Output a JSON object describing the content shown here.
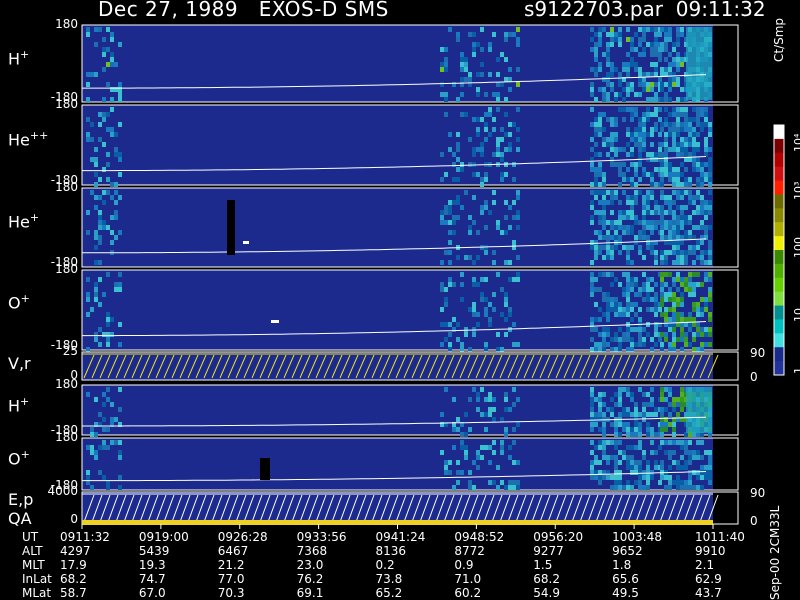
{
  "header": {
    "title": "Dec 27, 1989   EXOS-D SMS",
    "file": "s9122703.par  09:11:32"
  },
  "panels": [
    {
      "label_base": "H",
      "label_sup": "+",
      "top_tick": "180",
      "bottom_tick": "-180"
    },
    {
      "label_base": "He",
      "label_sup": "++",
      "top_tick": "180",
      "bottom_tick": "-180"
    },
    {
      "label_base": "He",
      "label_sup": "+",
      "top_tick": "180",
      "bottom_tick": "-180"
    },
    {
      "label_base": "O",
      "label_sup": "+",
      "top_tick": "180",
      "bottom_tick": "-180"
    },
    {
      "label_base": "V,r",
      "label_sup": "",
      "top_tick": "25",
      "bottom_tick": "0",
      "right_top": "90",
      "right_bottom": "0"
    },
    {
      "label_base": "H",
      "label_sup": "+",
      "top_tick": "180",
      "bottom_tick": "-180"
    },
    {
      "label_base": "O",
      "label_sup": "+",
      "top_tick": "180",
      "bottom_tick": "-180"
    },
    {
      "label_base": "E,p",
      "label_sup": "",
      "label2": "QA",
      "top_tick": "4000",
      "bottom_tick": "0",
      "right_top": "90",
      "right_bottom": "0"
    }
  ],
  "colorbar": {
    "unit": "Ct/Smp",
    "labels": [
      "10⁴",
      "10³",
      "100",
      "10",
      "1"
    ],
    "colors": [
      "#ffffff",
      "#7a0000",
      "#b00000",
      "#d01010",
      "#ff2000",
      "#6a6a00",
      "#8a8a00",
      "#b0b000",
      "#f0f000",
      "#3a8a00",
      "#50b000",
      "#66d000",
      "#80e040",
      "#009090",
      "#00c0c0",
      "#40e0e0",
      "#1a2a8a",
      "#223399"
    ]
  },
  "orbit": {
    "rows": [
      {
        "name": "UT",
        "values": [
          "0911:32",
          "0919:00",
          "0926:28",
          "0933:56",
          "0941:24",
          "0948:52",
          "0956:20",
          "1003:48",
          "1011:40"
        ]
      },
      {
        "name": "ALT",
        "values": [
          "4297",
          "5439",
          "6467",
          "7368",
          "8136",
          "8772",
          "9277",
          "9652",
          "9910"
        ]
      },
      {
        "name": "MLT",
        "values": [
          "17.9",
          "19.3",
          "21.2",
          "23.0",
          "0.2",
          "0.9",
          "1.5",
          "1.8",
          "2.1"
        ]
      },
      {
        "name": "InLat",
        "values": [
          "68.2",
          "74.7",
          "77.0",
          "76.2",
          "73.8",
          "71.0",
          "68.2",
          "65.6",
          "62.9"
        ]
      },
      {
        "name": "MLat",
        "values": [
          "58.7",
          "67.0",
          "70.3",
          "69.1",
          "65.2",
          "60.2",
          "54.9",
          "49.5",
          "43.7"
        ]
      }
    ]
  },
  "footer_stamp": "Sep-00 2CM33L",
  "chart_data": {
    "type": "heatmap",
    "title": "Dec 27, 1989   EXOS-D SMS",
    "x_ticks": [
      "0911:32",
      "0919:00",
      "0926:28",
      "0933:56",
      "0941:24",
      "0948:52",
      "0956:20",
      "1003:48",
      "1011:40"
    ],
    "panels": [
      "H+",
      "He++",
      "He+",
      "O+",
      "V,r",
      "H+",
      "O+",
      "E,p / QA"
    ],
    "y_range_pitch": [
      -180,
      180
    ],
    "colorbar_unit": "Ct/Smp",
    "colorbar_range": [
      1,
      10000
    ],
    "log_scale": true
  }
}
